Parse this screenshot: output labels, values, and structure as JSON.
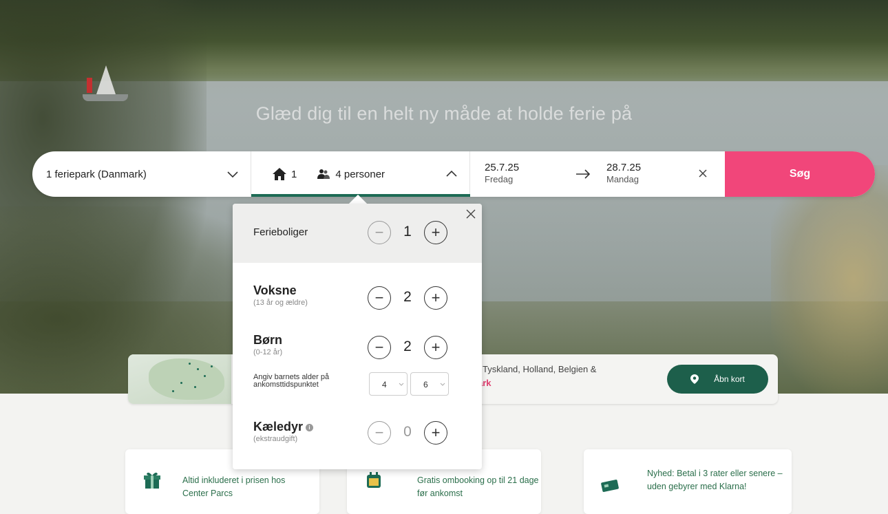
{
  "hero": {
    "headline": "Glæd dig til en helt ny måde at holde ferie på"
  },
  "search": {
    "park_label": "1 feriepark (Danmark)",
    "houses_count": "1",
    "persons_label": "4 personer",
    "checkin_date": "25.7.25",
    "checkin_day": "Fredag",
    "checkout_date": "28.7.25",
    "checkout_day": "Mandag",
    "search_label": "Søg"
  },
  "popup": {
    "houses": {
      "label": "Ferieboliger",
      "value": "1"
    },
    "adults": {
      "label": "Voksne",
      "sub": "(13 år og ældre)",
      "value": "2"
    },
    "children": {
      "label": "Børn",
      "sub": "(0-12 år)",
      "value": "2"
    },
    "child_age_label": "Angiv barnets alder på ankomsttidspunktet",
    "child_ages": [
      "4",
      "6"
    ],
    "pets": {
      "label": "Kæledyr",
      "sub": "(ekstraudgift)",
      "value": "0"
    }
  },
  "info": {
    "countries_text": ", Tyskland, Holland, Belgien &",
    "link_text": "ark",
    "map_button": "Åbn kort"
  },
  "features": [
    {
      "text": "Altid inkluderet i prisen hos Center Parcs",
      "icon": "gift-icon"
    },
    {
      "text": "Gratis ombooking op til 21 dage før ankomst",
      "icon": "calendar-icon"
    },
    {
      "text": "Nyhed: Betal i 3 rater eller senere – uden gebyrer med Klarna!",
      "icon": "payment-card-icon"
    }
  ],
  "colors": {
    "accent_green": "#1d6b55",
    "search_pink": "#f1467a"
  }
}
